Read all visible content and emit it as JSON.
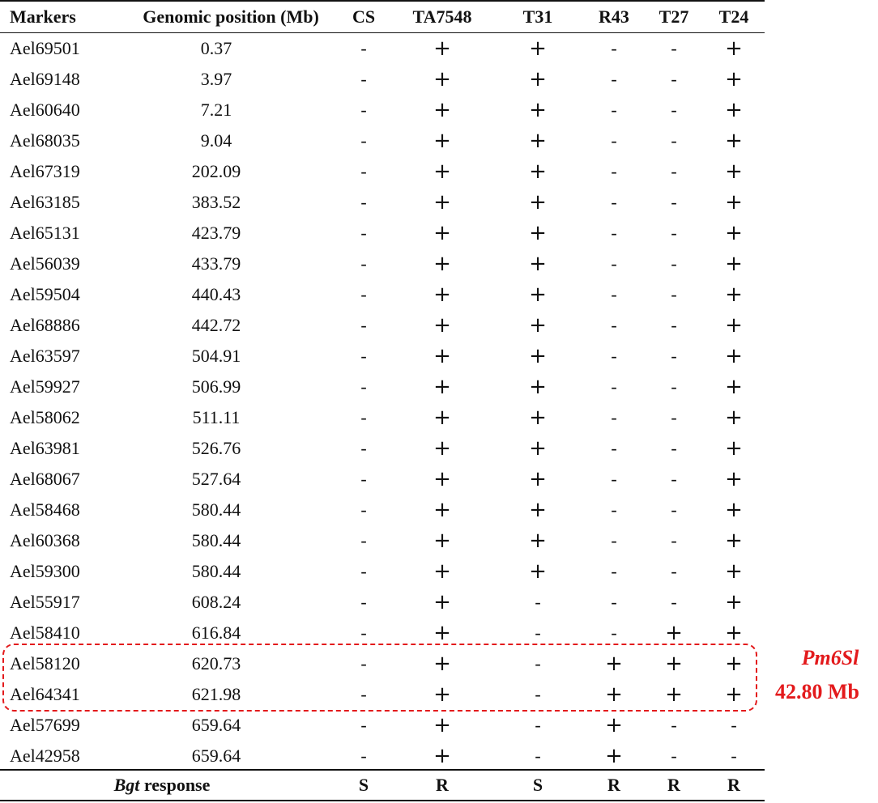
{
  "table": {
    "headers": {
      "marker": "Markers",
      "position": "Genomic position (Mb)",
      "cs": "CS",
      "ta7548": "TA7548",
      "t31": "T31",
      "r43": "R43",
      "t27": "T27",
      "t24": "T24"
    },
    "rows": [
      {
        "marker": "Ael69501",
        "position": "0.37",
        "cs": "-",
        "ta7548": "+",
        "t31": "+",
        "r43": "-",
        "t27": "-",
        "t24": "+"
      },
      {
        "marker": "Ael69148",
        "position": "3.97",
        "cs": "-",
        "ta7548": "+",
        "t31": "+",
        "r43": "-",
        "t27": "-",
        "t24": "+"
      },
      {
        "marker": "Ael60640",
        "position": "7.21",
        "cs": "-",
        "ta7548": "+",
        "t31": "+",
        "r43": "-",
        "t27": "-",
        "t24": "+"
      },
      {
        "marker": "Ael68035",
        "position": "9.04",
        "cs": "-",
        "ta7548": "+",
        "t31": "+",
        "r43": "-",
        "t27": "-",
        "t24": "+"
      },
      {
        "marker": "Ael67319",
        "position": "202.09",
        "cs": "-",
        "ta7548": "+",
        "t31": "+",
        "r43": "-",
        "t27": "-",
        "t24": "+"
      },
      {
        "marker": "Ael63185",
        "position": "383.52",
        "cs": "-",
        "ta7548": "+",
        "t31": "+",
        "r43": "-",
        "t27": "-",
        "t24": "+"
      },
      {
        "marker": "Ael65131",
        "position": "423.79",
        "cs": "-",
        "ta7548": "+",
        "t31": "+",
        "r43": "-",
        "t27": "-",
        "t24": "+"
      },
      {
        "marker": "Ael56039",
        "position": "433.79",
        "cs": "-",
        "ta7548": "+",
        "t31": "+",
        "r43": "-",
        "t27": "-",
        "t24": "+"
      },
      {
        "marker": "Ael59504",
        "position": "440.43",
        "cs": "-",
        "ta7548": "+",
        "t31": "+",
        "r43": "-",
        "t27": "-",
        "t24": "+"
      },
      {
        "marker": "Ael68886",
        "position": "442.72",
        "cs": "-",
        "ta7548": "+",
        "t31": "+",
        "r43": "-",
        "t27": "-",
        "t24": "+"
      },
      {
        "marker": "Ael63597",
        "position": "504.91",
        "cs": "-",
        "ta7548": "+",
        "t31": "+",
        "r43": "-",
        "t27": "-",
        "t24": "+"
      },
      {
        "marker": "Ael59927",
        "position": "506.99",
        "cs": "-",
        "ta7548": "+",
        "t31": "+",
        "r43": "-",
        "t27": "-",
        "t24": "+"
      },
      {
        "marker": "Ael58062",
        "position": "511.11",
        "cs": "-",
        "ta7548": "+",
        "t31": "+",
        "r43": "-",
        "t27": "-",
        "t24": "+"
      },
      {
        "marker": "Ael63981",
        "position": "526.76",
        "cs": "-",
        "ta7548": "+",
        "t31": "+",
        "r43": "-",
        "t27": "-",
        "t24": "+"
      },
      {
        "marker": "Ael68067",
        "position": "527.64",
        "cs": "-",
        "ta7548": "+",
        "t31": "+",
        "r43": "-",
        "t27": "-",
        "t24": "+"
      },
      {
        "marker": "Ael58468",
        "position": "580.44",
        "cs": "-",
        "ta7548": "+",
        "t31": "+",
        "r43": "-",
        "t27": "-",
        "t24": "+"
      },
      {
        "marker": "Ael60368",
        "position": "580.44",
        "cs": "-",
        "ta7548": "+",
        "t31": "+",
        "r43": "-",
        "t27": "-",
        "t24": "+"
      },
      {
        "marker": "Ael59300",
        "position": "580.44",
        "cs": "-",
        "ta7548": "+",
        "t31": "+",
        "r43": "-",
        "t27": "-",
        "t24": "+"
      },
      {
        "marker": "Ael55917",
        "position": "608.24",
        "cs": "-",
        "ta7548": "+",
        "t31": "-",
        "r43": "-",
        "t27": "-",
        "t24": "+"
      },
      {
        "marker": "Ael58410",
        "position": "616.84",
        "cs": "-",
        "ta7548": "+",
        "t31": "-",
        "r43": "-",
        "t27": "+",
        "t24": "+"
      },
      {
        "marker": "Ael58120",
        "position": "620.73",
        "cs": "-",
        "ta7548": "+",
        "t31": "-",
        "r43": "+",
        "t27": "+",
        "t24": "+"
      },
      {
        "marker": "Ael64341",
        "position": "621.98",
        "cs": "-",
        "ta7548": "+",
        "t31": "-",
        "r43": "+",
        "t27": "+",
        "t24": "+"
      },
      {
        "marker": "Ael57699",
        "position": "659.64",
        "cs": "-",
        "ta7548": "+",
        "t31": "-",
        "r43": "+",
        "t27": "-",
        "t24": "-"
      },
      {
        "marker": "Ael42958",
        "position": "659.64",
        "cs": "-",
        "ta7548": "+",
        "t31": "-",
        "r43": "+",
        "t27": "-",
        "t24": "-"
      }
    ],
    "response": {
      "label_italic": "Bgt",
      "label_rest": " response",
      "cs": "S",
      "ta7548": "R",
      "t31": "S",
      "r43": "R",
      "t27": "R",
      "t24": "R"
    }
  },
  "highlight": {
    "gene": "Pm6Sl",
    "size": "42.80 Mb",
    "color": "#e31a1c"
  }
}
